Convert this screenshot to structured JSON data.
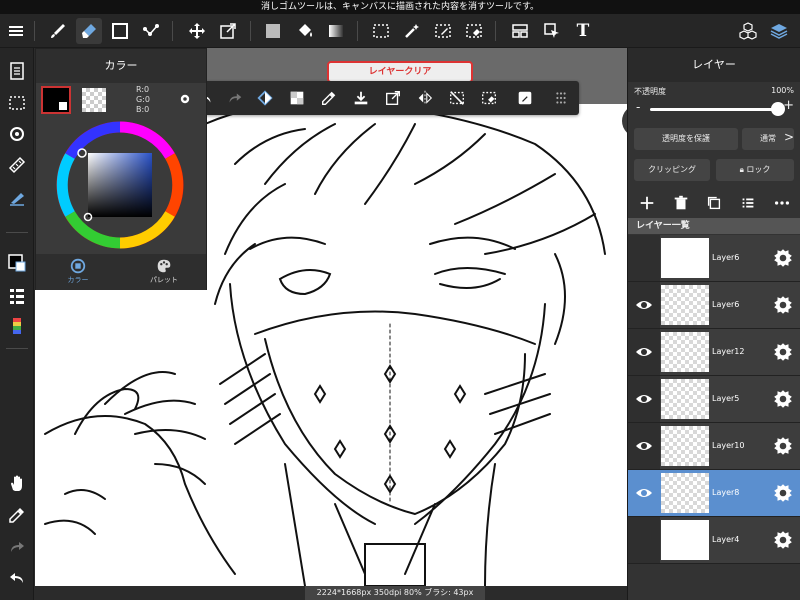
{
  "status_bar": {
    "text": "消しゴムツールは、キャンバスに描画された内容を消すツールです。"
  },
  "toolbar": {
    "menu_icon": "hamburger-icon",
    "tools": [
      "brush-icon",
      "eraser-icon",
      "rectangle-icon",
      "dotline-icon",
      "move-icon",
      "transform-icon",
      "fill-color-icon",
      "bucket-icon",
      "gradient-icon",
      "select-icon",
      "magic-wand-icon",
      "select-pen-icon",
      "select-eraser-icon",
      "frame-icon",
      "operation-icon",
      "text-icon",
      "3d-icon",
      "layers-icon"
    ],
    "text_tool_label": "T"
  },
  "canvas": {
    "clear_layer_label": "レイヤークリア",
    "info": "2224*1668px 350dpi 80% ブラシ: 43px 100%"
  },
  "color_panel": {
    "title": "カラー",
    "rgb": {
      "r": "R:0",
      "g": "G:0",
      "b": "B:0"
    },
    "tab_color": "カラー",
    "tab_palette": "パレット",
    "colors": {
      "main": "#000000",
      "sub": "#ffffff"
    }
  },
  "layer_panel": {
    "title": "レイヤー",
    "opacity_label": "不透明度",
    "opacity_value": "100%",
    "opacity_fraction": 1.0,
    "minus": "-",
    "plus": "+",
    "protect_alpha_label": "透明度を保護",
    "blend_mode": "通常",
    "blend_chevron": ">",
    "clipping_label": "クリッピング",
    "lock_label": "ロック",
    "list_header": "レイヤー一覧",
    "layers": [
      {
        "name": "Layer6",
        "visible": false,
        "selected": false
      },
      {
        "name": "Layer6",
        "visible": true,
        "selected": false
      },
      {
        "name": "Layer12",
        "visible": true,
        "selected": false
      },
      {
        "name": "Layer5",
        "visible": true,
        "selected": false
      },
      {
        "name": "Layer10",
        "visible": true,
        "selected": false
      },
      {
        "name": "Layer8",
        "visible": true,
        "selected": true
      },
      {
        "name": "Layer4",
        "visible": false,
        "selected": false
      }
    ]
  },
  "accent": {
    "selected_layer": "#5b8fcf",
    "clear_button": "#dd3333"
  }
}
